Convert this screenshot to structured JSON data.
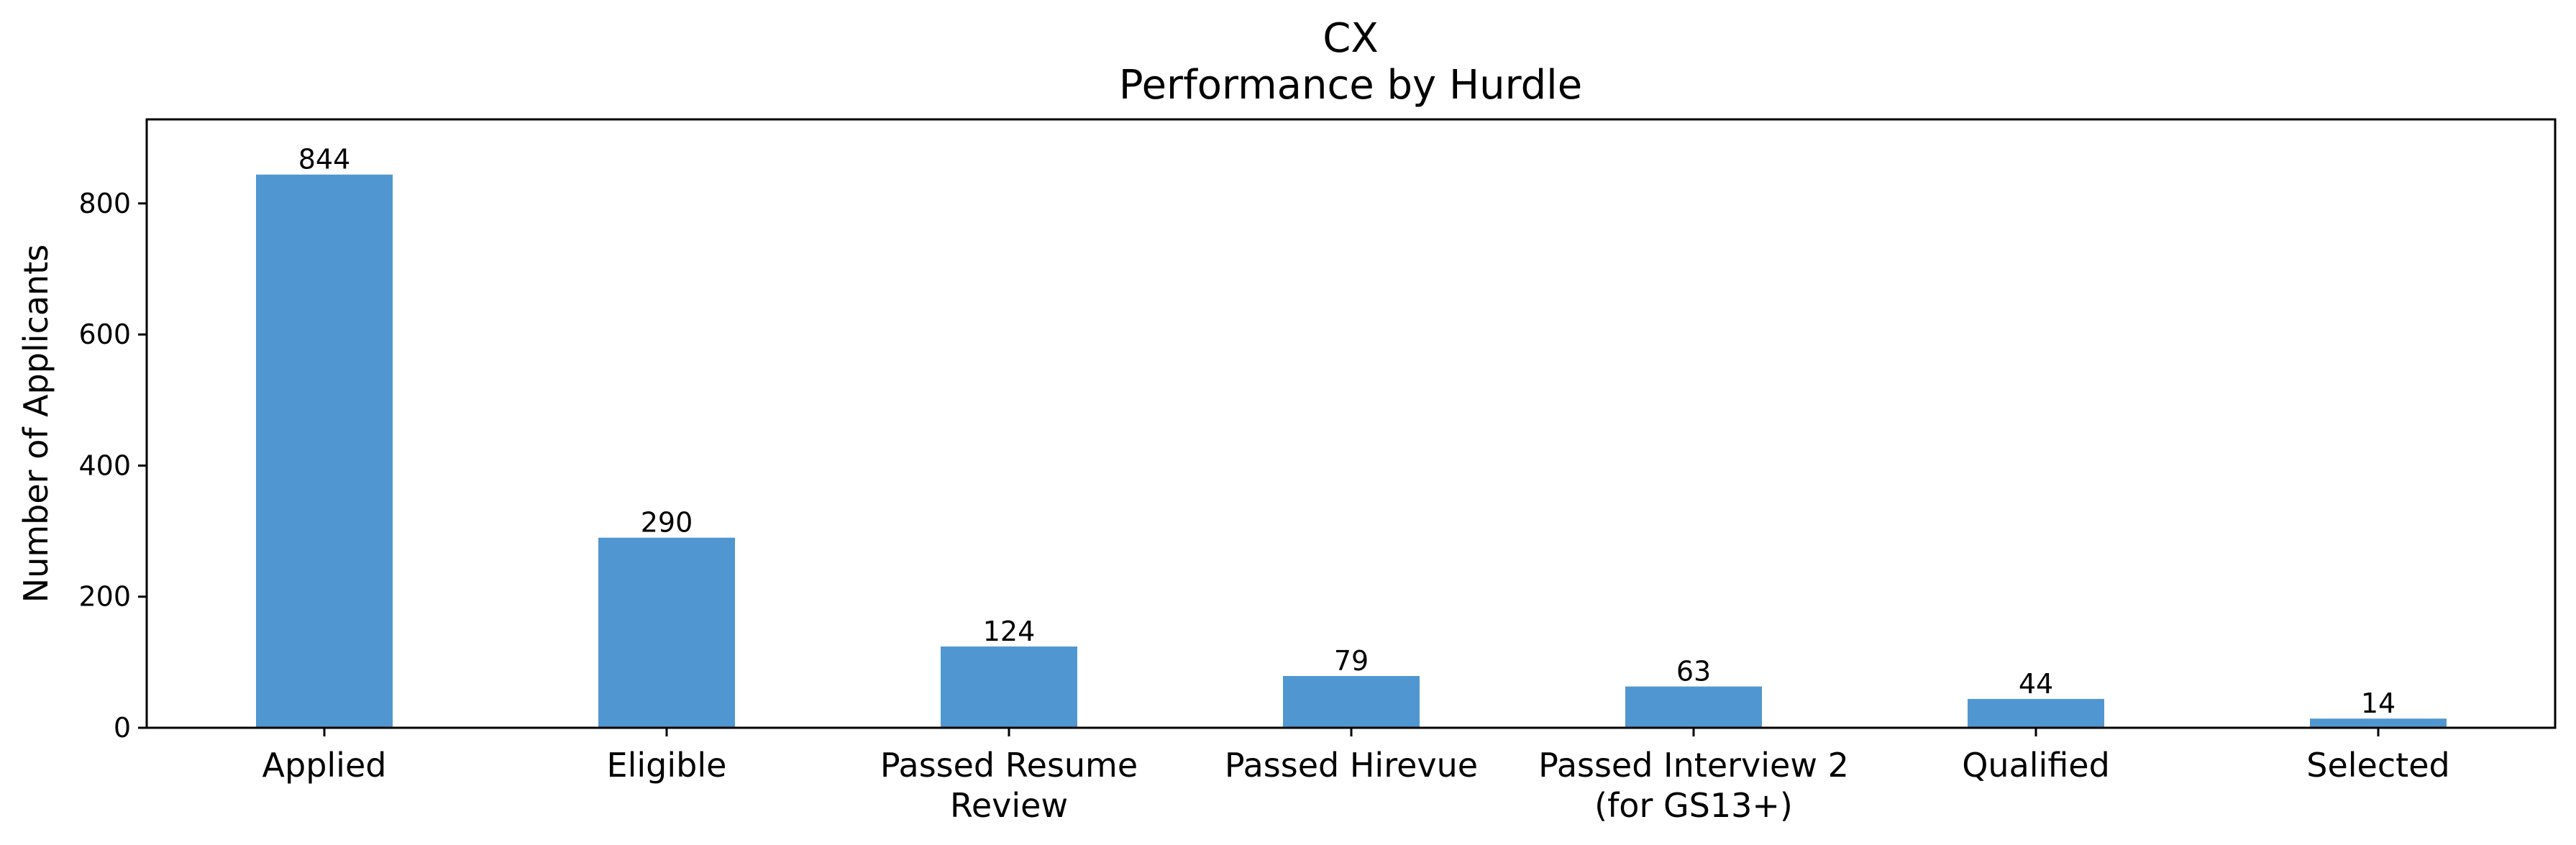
{
  "chart_data": {
    "type": "bar",
    "title": "CX",
    "subtitle": "Performance by Hurdle",
    "xlabel": "",
    "ylabel": "Number of Applicants",
    "categories": [
      [
        "Applied"
      ],
      [
        "Eligible"
      ],
      [
        "Passed Resume",
        "Review"
      ],
      [
        "Passed Hirevue"
      ],
      [
        "Passed Interview 2",
        "(for GS13+)"
      ],
      [
        "Qualified"
      ],
      [
        "Selected"
      ]
    ],
    "values": [
      844,
      290,
      124,
      79,
      63,
      44,
      14
    ],
    "data_labels": [
      "844",
      "290",
      "124",
      "79",
      "63",
      "44",
      "14"
    ],
    "ylim": [
      0,
      928.2
    ],
    "yticks": [
      0,
      200,
      400,
      600,
      800
    ],
    "ytick_labels": [
      "0",
      "200",
      "400",
      "600",
      "800"
    ],
    "grid": false,
    "legend": null,
    "bar_color": "#5097d1"
  }
}
